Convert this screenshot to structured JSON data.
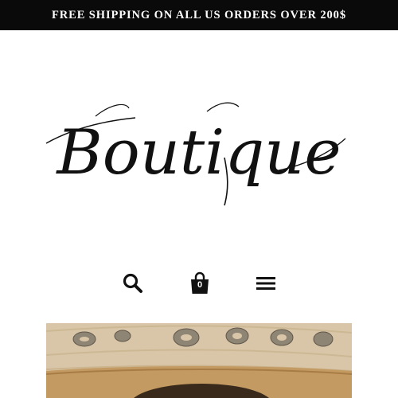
{
  "announcement": {
    "text": "FREE SHIPPING ON ALL US ORDERS OVER 200$"
  },
  "logo": {
    "text": "Boutique"
  },
  "header": {
    "icons": [
      "search-icon",
      "cart-icon",
      "menu-icon"
    ],
    "cart_count": "0"
  },
  "colors": {
    "announcement_bg": "#0a0a0a",
    "text_primary": "#111111",
    "hat_straw": "#d9c6a8",
    "hat_band": "#c39a62"
  }
}
